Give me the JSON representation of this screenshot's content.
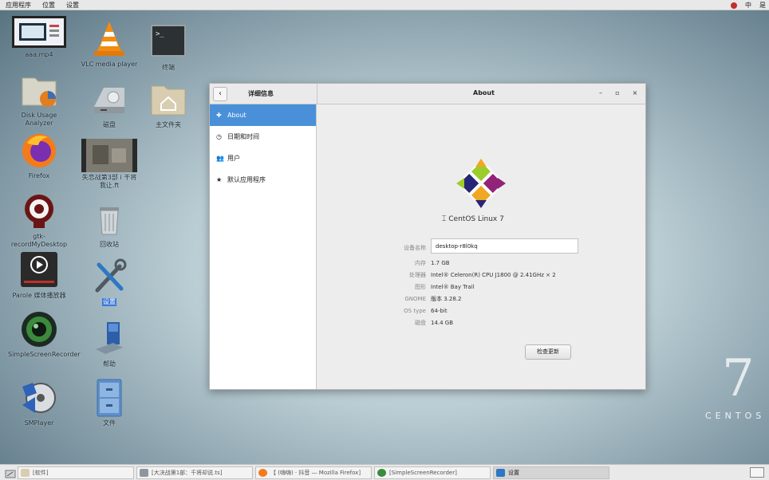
{
  "topbar": {
    "menu": [
      "应用程序",
      "位置",
      "设置"
    ],
    "indicators": [
      "中",
      "是"
    ]
  },
  "desktop_icons": [
    {
      "label": "aaa.mp4",
      "icon": "video-file-icon"
    },
    {
      "label": "VLC media player",
      "icon": "vlc-icon"
    },
    {
      "label": "终端",
      "icon": "terminal-icon"
    },
    {
      "label": "Disk Usage Analyzer",
      "icon": "disk-usage-icon"
    },
    {
      "label": "磁盘",
      "icon": "disk-drive-icon"
    },
    {
      "label": "主文件夹",
      "icon": "home-folder-icon"
    },
    {
      "label": "Firefox",
      "icon": "firefox-icon"
    },
    {
      "label": "失恋战第3部 i 干将 我让.ft",
      "icon": "film-file-icon"
    },
    {
      "label": "gtk-recordMyDesktop",
      "icon": "recordmydesktop-icon"
    },
    {
      "label": "回收站",
      "icon": "trash-icon"
    },
    {
      "label": "Parole 媒体播放器",
      "icon": "parole-icon"
    },
    {
      "label": "设置",
      "icon": "settings-tools-icon"
    },
    {
      "label": "SimpleScreenRecorder",
      "icon": "camera-lens-icon"
    },
    {
      "label": "帮助",
      "icon": "help-icon"
    },
    {
      "label": "SMPlayer",
      "icon": "smplayer-icon"
    },
    {
      "label": "文件",
      "icon": "file-cabinet-icon"
    }
  ],
  "brand": {
    "number": "7",
    "text": "CENTOS"
  },
  "settings_window": {
    "left_title": "详细信息",
    "title": "About",
    "controls": {
      "minimize": "–",
      "maximize": "▫",
      "close": "×"
    },
    "back": "‹",
    "sidebar": [
      {
        "label": "About",
        "glyph": "✚",
        "active": true
      },
      {
        "label": "日期和时间",
        "glyph": "◷",
        "active": false
      },
      {
        "label": "用户",
        "glyph": "👥",
        "active": false
      },
      {
        "label": "默认应用程序",
        "glyph": "★",
        "active": false
      }
    ],
    "os_name": "CentOS Linux 7",
    "device_name_label": "设备名称",
    "device_name": "desktop-r8l0kq",
    "info": [
      {
        "key": "内存",
        "value": "1.7 GB"
      },
      {
        "key": "处理器",
        "value": "Intel® Celeron(R) CPU J1800 @ 2.41GHz × 2"
      },
      {
        "key": "图形",
        "value": "Intel® Bay Trail"
      },
      {
        "key": "GNOME",
        "value": "版本 3.28.2"
      },
      {
        "key": "OS type",
        "value": "64-bit"
      },
      {
        "key": "磁盘",
        "value": "14.4 GB"
      }
    ],
    "update_button": "检查更新"
  },
  "taskbar": {
    "items": [
      "[软件]",
      "[大决战第1部：千将却说.ts]",
      "【 (嗨嗨) · 抖音 — Mozilla Firefox]",
      "[SimpleScreenRecorder]",
      "设置"
    ]
  }
}
